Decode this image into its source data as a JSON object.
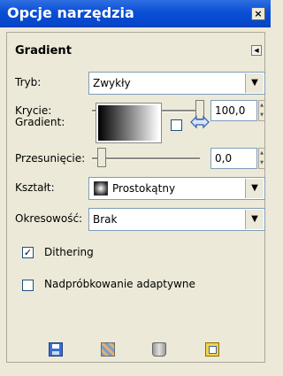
{
  "window": {
    "title": "Opcje narzędzia",
    "close": "×"
  },
  "section": {
    "title": "Gradient",
    "menu_icon": "tab-menu-icon"
  },
  "mode": {
    "label": "Tryb:",
    "value": "Zwykły"
  },
  "opacity": {
    "label": "Krycie:",
    "value": "100,0",
    "fraction": 1.0
  },
  "gradient": {
    "label": "Gradient:",
    "reverse_checked": false
  },
  "offset": {
    "label": "Przesunięcie:",
    "value": "0,0",
    "fraction": 0.0
  },
  "shape": {
    "label": "Kształt:",
    "value": "Prostokątny"
  },
  "repeat": {
    "label": "Okresowość:",
    "value": "Brak"
  },
  "dithering": {
    "label": "Dithering",
    "checked": true
  },
  "adaptive": {
    "label": "Nadpróbkowanie adaptywne",
    "checked": false
  },
  "toolbar": {
    "icons": [
      "save-options-icon",
      "restore-options-icon",
      "delete-options-icon",
      "reset-options-icon"
    ]
  },
  "colors": {
    "titlebar": "#0a4fd6",
    "bg": "#ece9d8"
  }
}
